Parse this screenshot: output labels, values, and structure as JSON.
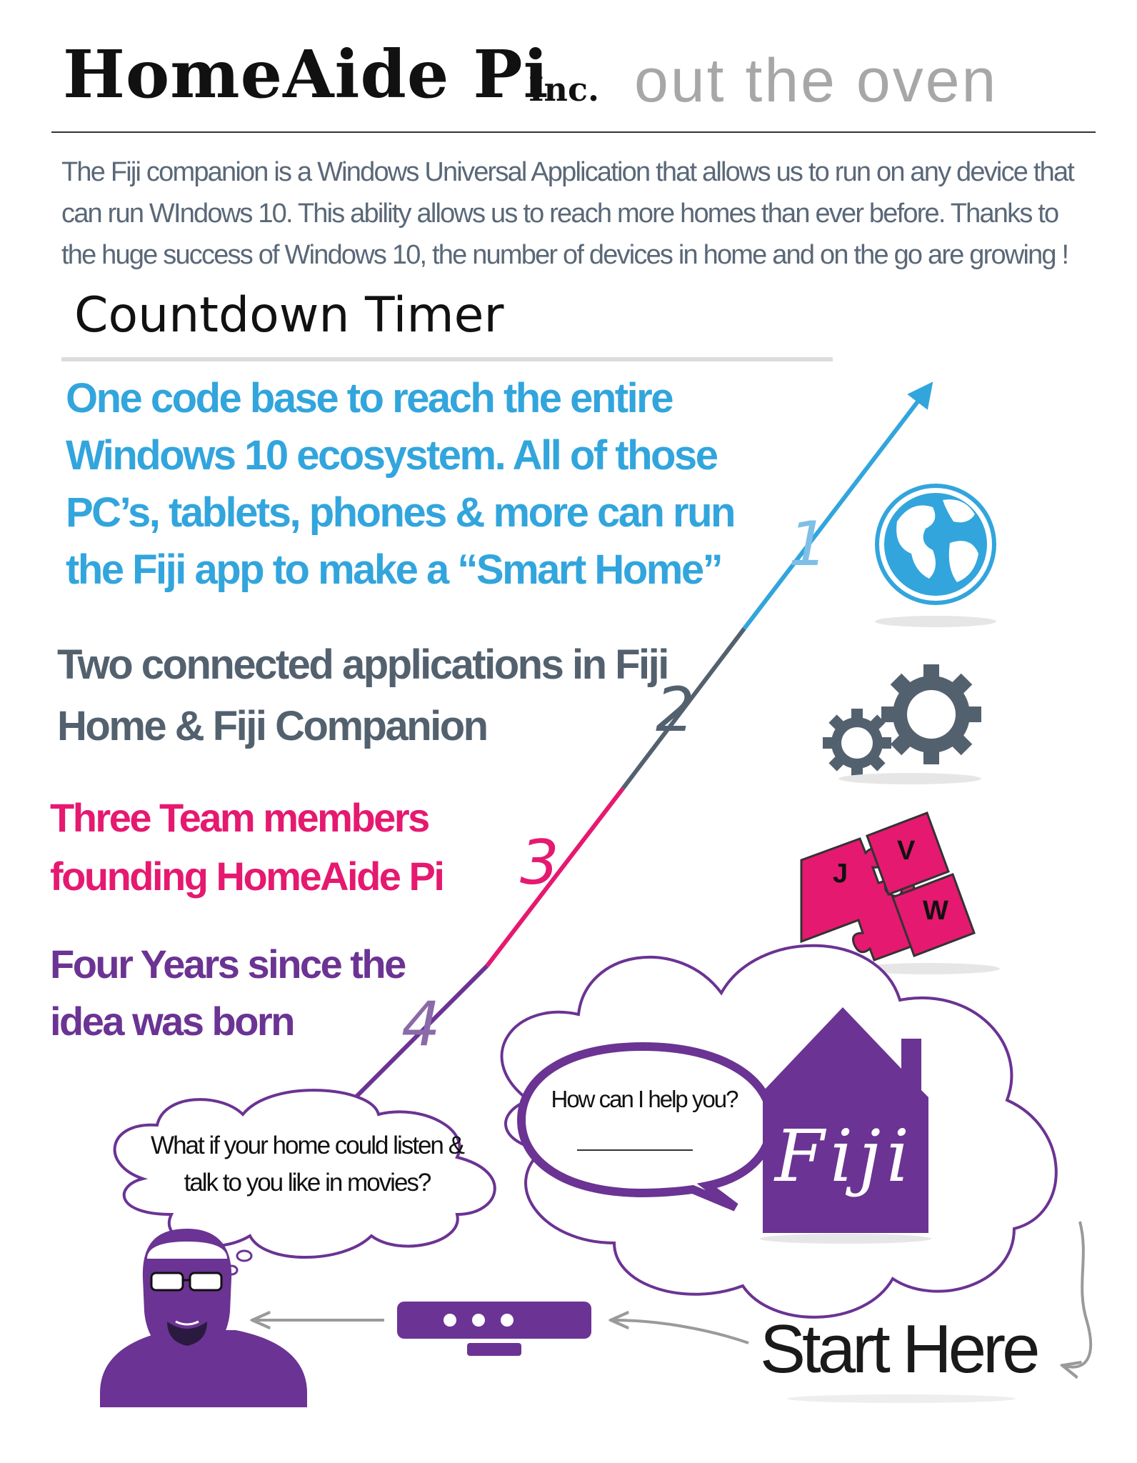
{
  "header": {
    "brand": "HomeAide Pi",
    "inc": "Inc.",
    "tagline": "out the oven"
  },
  "intro": "The Fiji companion is a Windows Universal Application that allows us to run on any device that can run WIndows 10.  This ability allows us to reach more homes than ever before. Thanks to the huge success of Windows 10, the number of devices in home and on the go are growing !",
  "countdown": {
    "title": "Countdown Timer",
    "items": [
      {
        "number": "1",
        "text": "One code base to reach the entire Windows 10 ecosystem. All of those PC’s, tablets, phones & more can run the Fiji app to make a “Smart Home”",
        "icon": "globe-icon",
        "color": "#32a5dd"
      },
      {
        "number": "2",
        "text": "Two connected applications in Fiji Home & Fiji Companion",
        "icon": "gears-icon",
        "color": "#53616f"
      },
      {
        "number": "3",
        "text": "Three Team members founding HomeAide Pi",
        "icon": "puzzle-icon",
        "color": "#e5196f"
      },
      {
        "number": "4",
        "text": "Four Years since the idea was born",
        "icon": "timeline-arrow-icon",
        "color": "#6b3393"
      }
    ]
  },
  "puzzle_letters": [
    "J",
    "V",
    "W"
  ],
  "flow": {
    "thought": "What if your home could listen & talk to you like in movies?",
    "speech": "How can I help you?",
    "house_label": "Fiji",
    "start": "Start Here"
  },
  "colors": {
    "blue": "#32a5dd",
    "slate": "#53616f",
    "pink": "#e5196f",
    "purple": "#6b3393",
    "gray": "#a7a7a7"
  }
}
